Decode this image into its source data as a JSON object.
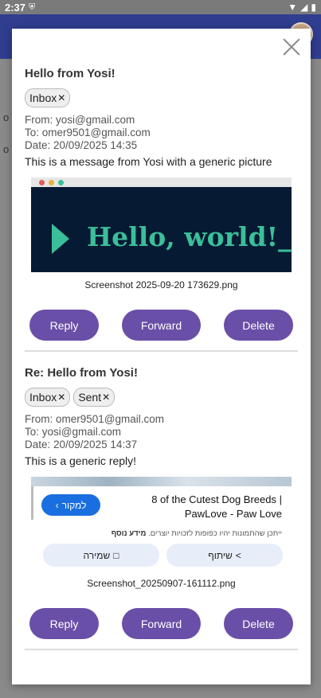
{
  "status_bar": {
    "time": "2:37"
  },
  "background": {
    "letters": [
      "o",
      "o"
    ]
  },
  "messages": [
    {
      "subject": "Hello from Yosi!",
      "tags": [
        "Inbox"
      ],
      "from": "From: yosi@gmail.com",
      "to": "To: omer9501@gmail.com",
      "date": "Date: 20/09/2025 14:35",
      "body": "This is a message from Yosi with a generic picture",
      "attachment": {
        "image_text": "Hello, world!_",
        "dot_colors": [
          "#e05a5a",
          "#e8b23c",
          "#3bbf9a"
        ],
        "filename": "Screenshot 2025-09-20 173629.png"
      }
    },
    {
      "subject": "Re: Hello from Yosi!",
      "tags": [
        "Inbox",
        "Sent"
      ],
      "from": "From: omer9501@gmail.com",
      "to": "To: yosi@gmail.com",
      "date": "Date: 20/09/2025 14:37",
      "body": "This is a generic reply!",
      "attachment": {
        "source_button": "למקור",
        "title_line1": "8 of the Cutest Dog Breeds |",
        "title_line2": "PawLove - Paw Love",
        "note_bold": "מידע נוסף",
        "note_text": "ייתכן שהתמונות יהיו כפופות לזכויות יוצרים.",
        "save_label": "שמירה",
        "share_label": "שיתוף",
        "filename": "Screenshot_20250907-161112.png"
      }
    }
  ],
  "actions": {
    "reply": "Reply",
    "forward": "Forward",
    "delete": "Delete"
  },
  "colors": {
    "accent": "#6a4fa8",
    "app_bar": "#2f3e8f",
    "source_button": "#1a6fe0"
  }
}
